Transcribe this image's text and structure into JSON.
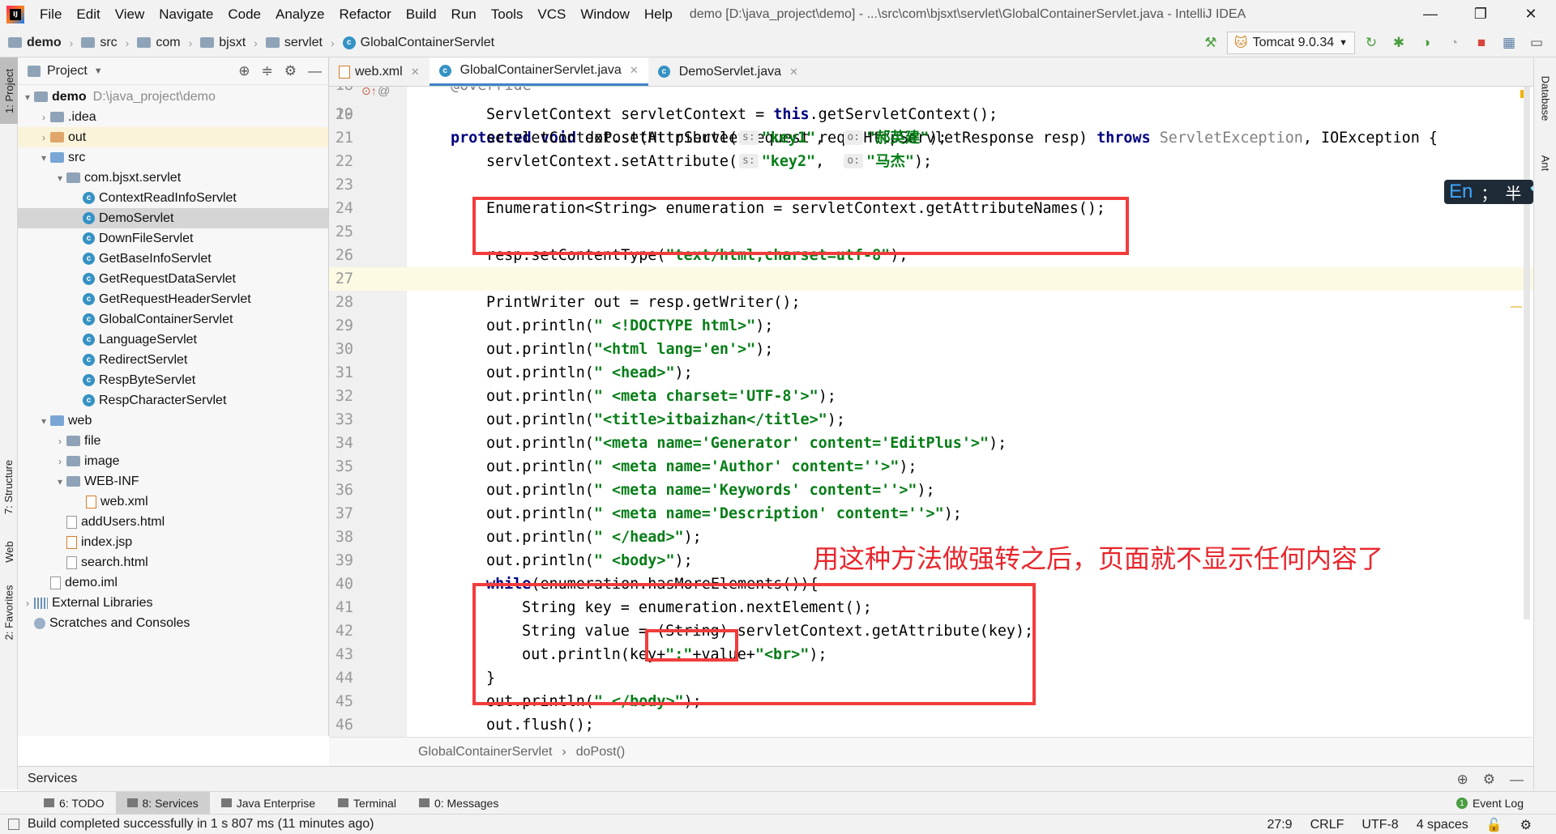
{
  "window": {
    "title": "demo [D:\\java_project\\demo] - ...\\src\\com\\bjsxt\\servlet\\GlobalContainerServlet.java - IntelliJ IDEA",
    "menu": [
      "File",
      "Edit",
      "View",
      "Navigate",
      "Code",
      "Analyze",
      "Refactor",
      "Build",
      "Run",
      "Tools",
      "VCS",
      "Window",
      "Help"
    ],
    "controls": {
      "minimize": "—",
      "maximize": "❐",
      "close": "✕"
    }
  },
  "navbar": {
    "breadcrumbs": [
      "demo",
      "src",
      "com",
      "bjsxt",
      "servlet",
      "GlobalContainerServlet"
    ],
    "run_config": "Tomcat 9.0.34"
  },
  "left_strip": {
    "project": "1: Project",
    "structure": "7: Structure",
    "web": "Web",
    "favorites": "2: Favorites"
  },
  "right_strip": {
    "database": "Database",
    "ant": "Ant"
  },
  "project_panel": {
    "title": "Project",
    "tree": [
      {
        "label": "demo",
        "path": "D:\\java_project\\demo"
      },
      {
        "label": ".idea"
      },
      {
        "label": "out"
      },
      {
        "label": "src"
      },
      {
        "label": "com.bjsxt.servlet"
      },
      {
        "label": "ContextReadInfoServlet"
      },
      {
        "label": "DemoServlet"
      },
      {
        "label": "DownFileServlet"
      },
      {
        "label": "GetBaseInfoServlet"
      },
      {
        "label": "GetRequestDataServlet"
      },
      {
        "label": "GetRequestHeaderServlet"
      },
      {
        "label": "GlobalContainerServlet"
      },
      {
        "label": "LanguageServlet"
      },
      {
        "label": "RedirectServlet"
      },
      {
        "label": "RespByteServlet"
      },
      {
        "label": "RespCharacterServlet"
      },
      {
        "label": "web"
      },
      {
        "label": "file"
      },
      {
        "label": "image"
      },
      {
        "label": "WEB-INF"
      },
      {
        "label": "web.xml"
      },
      {
        "label": "addUsers.html"
      },
      {
        "label": "index.jsp"
      },
      {
        "label": "search.html"
      },
      {
        "label": "demo.iml"
      },
      {
        "label": "External Libraries"
      },
      {
        "label": "Scratches and Consoles"
      }
    ],
    "selected_item": "DemoServlet"
  },
  "editor_tabs": [
    "web.xml",
    "GlobalContainerServlet.java",
    "DemoServlet.java"
  ],
  "active_tab": "GlobalContainerServlet.java",
  "editor": {
    "lines": [
      {
        "n": "18",
        "text": "@Override"
      },
      {
        "n": "19",
        "text": "protected void doPost(HttpServletRequest req, HttpServletResponse resp) throws ServletException, IOException {"
      },
      {
        "n": "20",
        "text": "ServletContext servletContext = this.getServletContext();"
      },
      {
        "n": "21",
        "text": "servletContext.setAttribute( s: \"key1\",  o: \"郝英建\");"
      },
      {
        "n": "22",
        "text": "servletContext.setAttribute( s: \"key2\",  o: \"马杰\");"
      },
      {
        "n": "23",
        "text": ""
      },
      {
        "n": "24",
        "text": "Enumeration<String> enumeration = servletContext.getAttributeNames();"
      },
      {
        "n": "25",
        "text": ""
      },
      {
        "n": "26",
        "text": "resp.setContentType(\"text/html;charset=utf-8\");"
      },
      {
        "n": "27",
        "text": ""
      },
      {
        "n": "28",
        "text": "PrintWriter out = resp.getWriter();"
      },
      {
        "n": "29",
        "text": "out.println(\" <!DOCTYPE html>\");"
      },
      {
        "n": "30",
        "text": "out.println(\"<html lang='en'>\");"
      },
      {
        "n": "31",
        "text": "out.println(\" <head>\");"
      },
      {
        "n": "32",
        "text": "out.println(\" <meta charset='UTF-8'>\");"
      },
      {
        "n": "33",
        "text": "out.println(\"<title>itbaizhan</title>\");"
      },
      {
        "n": "34",
        "text": "out.println(\"<meta name='Generator' content='EditPlus'>\");"
      },
      {
        "n": "35",
        "text": "out.println(\" <meta name='Author' content=''>\");"
      },
      {
        "n": "36",
        "text": "out.println(\" <meta name='Keywords' content=''>\");"
      },
      {
        "n": "37",
        "text": "out.println(\" <meta name='Description' content=''>\");"
      },
      {
        "n": "38",
        "text": "out.println(\" </head>\");"
      },
      {
        "n": "39",
        "text": "out.println(\" <body>\");"
      },
      {
        "n": "40",
        "text": "while(enumeration.hasMoreElements()){"
      },
      {
        "n": "41",
        "text": "String key = enumeration.nextElement();"
      },
      {
        "n": "42",
        "text": "String value = (String) servletContext.getAttribute(key);"
      },
      {
        "n": "43",
        "text": "out.println(key+\":\"+value+\"<br>\");"
      },
      {
        "n": "44",
        "text": "}"
      },
      {
        "n": "45",
        "text": "out.println(\" </body>\");"
      },
      {
        "n": "46",
        "text": "out.flush();"
      }
    ],
    "current_line": "27",
    "annotation": "用这种方法做强转之后，页面就不显示任何内容了"
  },
  "editor_breadcrumb": [
    "GlobalContainerServlet",
    "doPost()"
  ],
  "services_panel": {
    "title": "Services"
  },
  "bottom_tabs": [
    {
      "label": "6: TODO"
    },
    {
      "label": "8: Services"
    },
    {
      "label": "Java Enterprise"
    },
    {
      "label": "Terminal"
    },
    {
      "label": "0: Messages"
    }
  ],
  "event_log": "Event Log",
  "status": {
    "message": "Build completed successfully in 1 s 807 ms (11 minutes ago)",
    "position": "27:9",
    "line_separator": "CRLF",
    "encoding": "UTF-8",
    "indent": "4 spaces"
  },
  "ime": {
    "lang": "En",
    "punct": "；",
    "width": "半"
  },
  "colors": {
    "keyword": "#000080",
    "string": "#067d17",
    "annotation_red": "#e8262c",
    "highlight_box": "#f23c3c",
    "current_line": "#fcfae3"
  }
}
